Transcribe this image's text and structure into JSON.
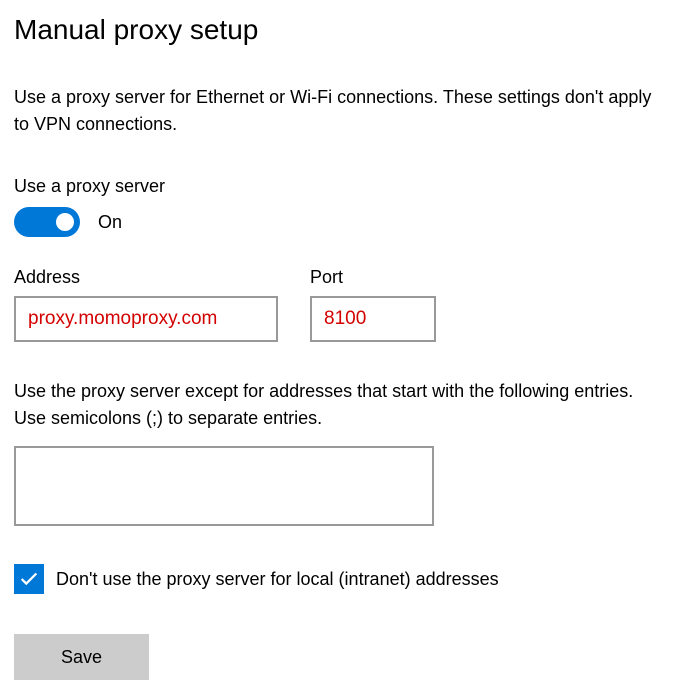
{
  "title": "Manual proxy setup",
  "description": "Use a proxy server for Ethernet or Wi-Fi connections. These settings don't apply to VPN connections.",
  "proxy_toggle": {
    "label": "Use a proxy server",
    "state_text": "On",
    "on": true
  },
  "address": {
    "label": "Address",
    "value": "proxy.momoproxy.com"
  },
  "port": {
    "label": "Port",
    "value": "8100"
  },
  "exceptions": {
    "label": "Use the proxy server except for addresses that start with the following entries. Use semicolons (;) to separate entries.",
    "value": ""
  },
  "local_bypass": {
    "label": "Don't use the proxy server for local (intranet) addresses",
    "checked": true
  },
  "save_label": "Save",
  "colors": {
    "accent": "#0078d7",
    "input_text": "#d40000"
  }
}
